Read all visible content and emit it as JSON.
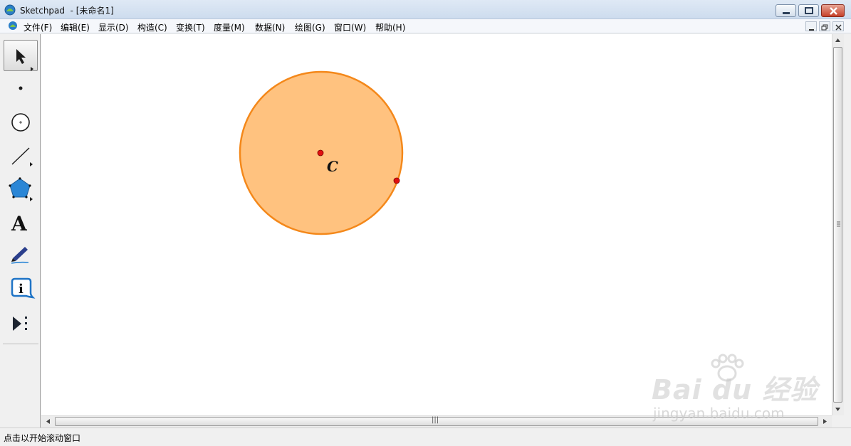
{
  "window": {
    "title": "Sketchpad  - [未命名1]"
  },
  "menubar": {
    "items": [
      {
        "label": "文件(F)"
      },
      {
        "label": "编辑(E)"
      },
      {
        "label": "显示(D)"
      },
      {
        "label": "构造(C)"
      },
      {
        "label": "变换(T)"
      },
      {
        "label": "度量(M)"
      },
      {
        "label": "数据(N)"
      },
      {
        "label": "绘图(G)"
      },
      {
        "label": "窗口(W)"
      },
      {
        "label": "帮助(H)"
      }
    ]
  },
  "toolbox": {
    "tools": [
      {
        "icon": "arrow-select-icon",
        "selected": true
      },
      {
        "icon": "point-icon"
      },
      {
        "icon": "compass-icon"
      },
      {
        "icon": "straightedge-icon"
      },
      {
        "icon": "polygon-icon"
      },
      {
        "icon": "text-icon",
        "glyph": "A"
      },
      {
        "icon": "marker-icon"
      },
      {
        "icon": "information-icon"
      },
      {
        "icon": "custom-tool-icon"
      }
    ]
  },
  "canvas": {
    "circle": {
      "center_label": "C",
      "fill_color": "#FFC27F",
      "stroke_color": "#F4881A",
      "point_color": "#E01010"
    }
  },
  "statusbar": {
    "text": "点击以开始滚动窗口"
  },
  "watermark": {
    "brand": "Bai du 经验",
    "url": "jingyan.baidu.com"
  },
  "scrollbars": {
    "grip": "|||"
  }
}
